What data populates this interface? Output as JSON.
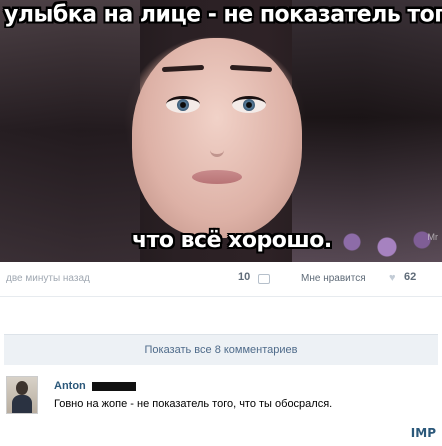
{
  "post": {
    "top_caption": "улыбка на лице - не показатель того,",
    "bottom_caption": "что всё хорошо.",
    "watermark": "Mr",
    "time": "две минуты назад",
    "comments_count": "10",
    "likes_label": "Мне нравится",
    "likes_count": "62",
    "show_all_comments": "Показать все 8 комментариев"
  },
  "comment": {
    "author": "Anton",
    "text": "Говно на жопе - не показатель того, что ты обосрался."
  },
  "site_logo": "IMP",
  "colors": {
    "link": "#2b587a",
    "meta": "#a0a8b2",
    "show_all_bg": "#edf1f5"
  }
}
